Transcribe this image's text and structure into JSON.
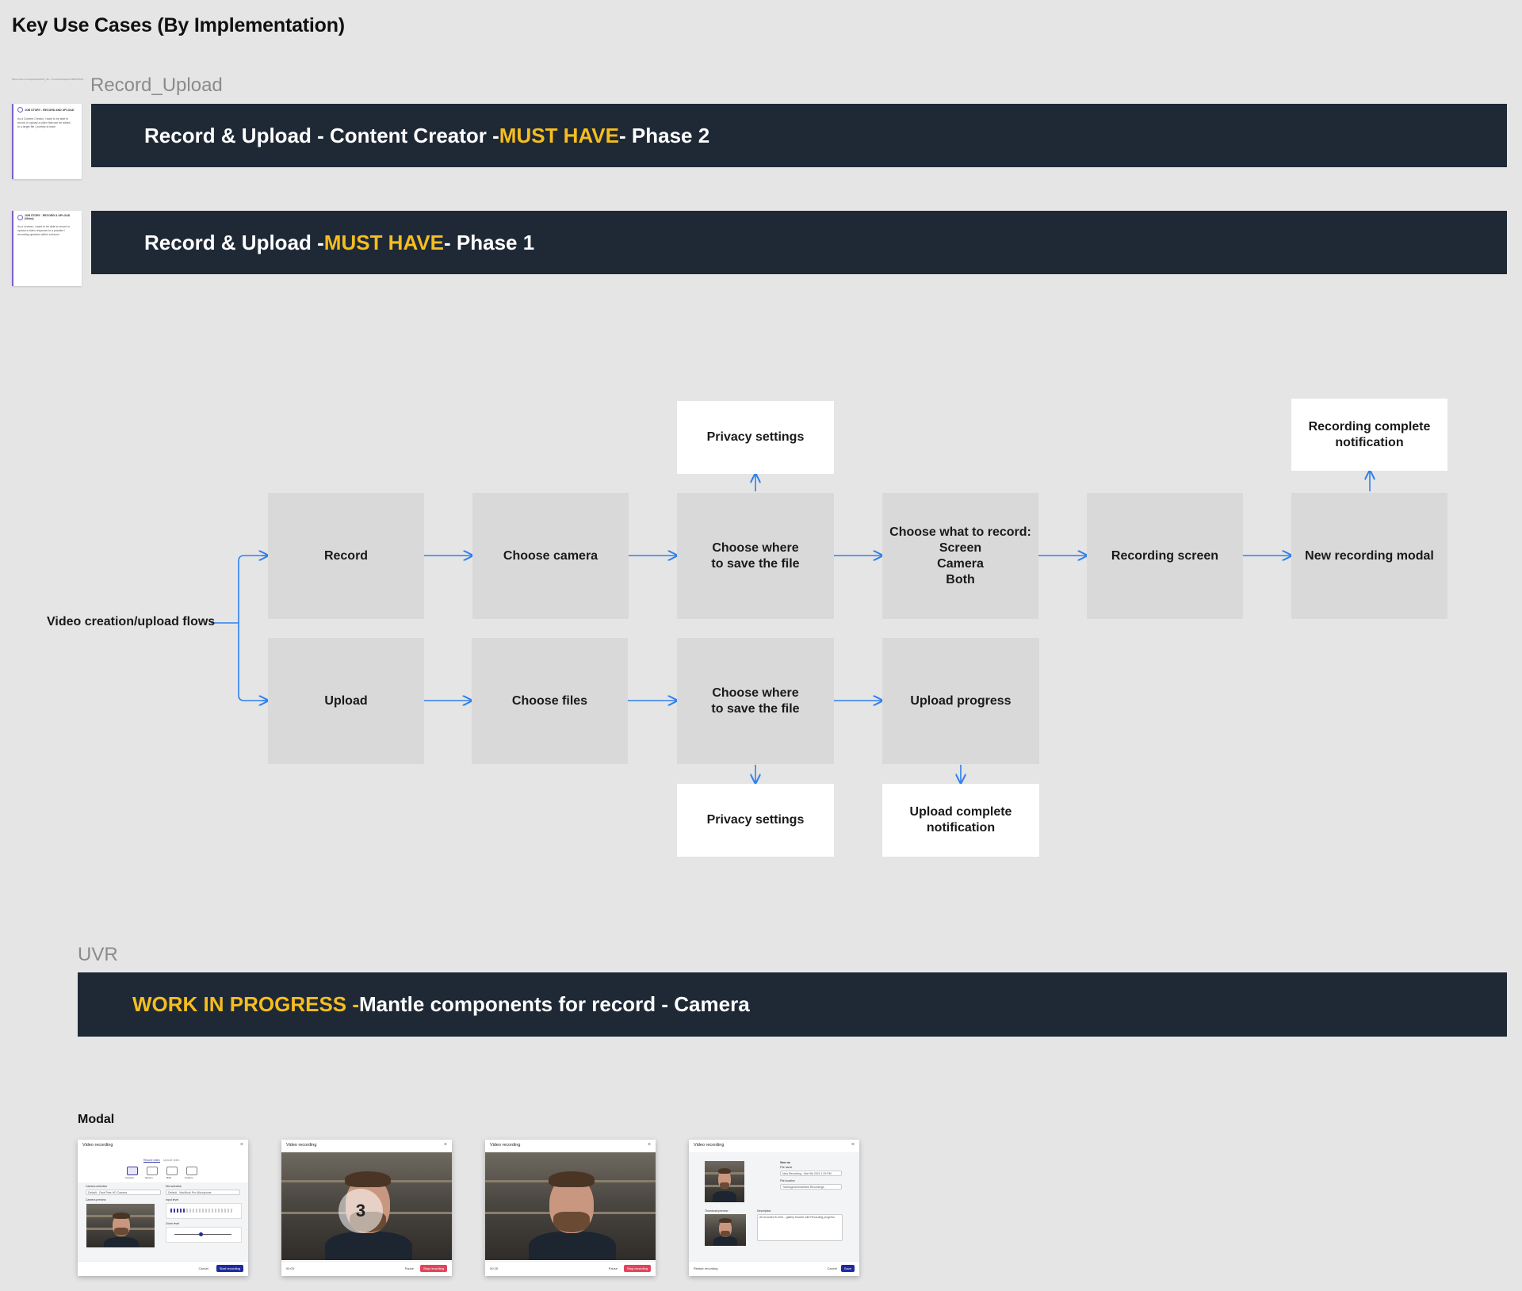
{
  "page_title": "Key Use Cases (By Implementation)",
  "sections": {
    "record_upload_label": "Record_Upload",
    "uvr_label": "UVR"
  },
  "tiny_url": "https://miro.com/app/board/o9J_lGi.../?moveToWidget=3458764513...",
  "banners": {
    "b1": {
      "pre": "Record & Upload - Content Creator - ",
      "highlight": "MUST HAVE",
      "post": " - Phase 2"
    },
    "b2": {
      "pre": "Record & Upload - ",
      "highlight": "MUST HAVE",
      "post": " - Phase 1"
    },
    "b3": {
      "highlight": "WORK IN PROGRESS - ",
      "post": "Mantle components for record - Camera"
    }
  },
  "stickies": [
    {
      "title": "JOB STORY - RECORD AND UPLOAD",
      "body": "As a Content Creator, I want to be able to record or upload a video that can be added to a larger file / journey to learn"
    },
    {
      "title": "JOB STORY - RECORD & UPLOAD (Video)",
      "body": "As a Learner, I want to be able to record or upload a video response to a practice / recording question within a lesson"
    }
  ],
  "flow": {
    "root": "Video creation/upload flows",
    "record_row": [
      "Record",
      "Choose camera",
      "Choose where\nto save the file",
      "Choose what to record:\nScreen\nCamera\nBoth",
      "Recording screen",
      "New recording modal"
    ],
    "record_extras": [
      "Privacy settings",
      "Recording complete\nnotification"
    ],
    "upload_row": [
      "Upload",
      "Choose files",
      "Choose where\nto save the file",
      "Upload progress"
    ],
    "upload_extras": [
      "Privacy settings",
      "Upload complete\nnotification"
    ]
  },
  "modal_label": "Modal",
  "thumbs": {
    "title": "Video recording",
    "close": "×",
    "t1": {
      "tabs": [
        "Record video",
        "Upload video"
      ],
      "icons": [
        "Camera",
        "Screen",
        "Both",
        "Custom"
      ],
      "camera_label": "Camera selection",
      "camera_value": "Default - FaceTime HD Camera",
      "mic_label": "Mic selection",
      "mic_value": "Default - MacBook Pro Microphone",
      "preview_label": "Camera preview",
      "input_label": "Input level",
      "zoom_label": "Zoom level",
      "cancel": "Cancel",
      "start": "Start recording"
    },
    "t2": {
      "time": "00:03",
      "countdown": "3",
      "pause": "Pause",
      "stop": "Stop recording"
    },
    "t3": {
      "time": "00:25",
      "pause": "Pause",
      "stop": "Stop recording"
    },
    "t4": {
      "section": "Save as",
      "file_label": "File name",
      "file_value": "New Recording - Mar 9th 2021 1:29 PM",
      "loc_label": "File location",
      "loc_value": "Training/General/New Recordings",
      "thumb_label": "Thumbnail preview",
      "desc_label": "Description",
      "desc_value": "All recorded 8-2021 - gallery browse with Recording progress",
      "retake": "Retake recording",
      "cancel": "Cancel",
      "save": "Save"
    }
  },
  "colors": {
    "banner_bg": "#1f2936",
    "highlight": "#f5bd1f",
    "arrow": "#2f80ed",
    "gray_node": "#d9d9d9"
  }
}
